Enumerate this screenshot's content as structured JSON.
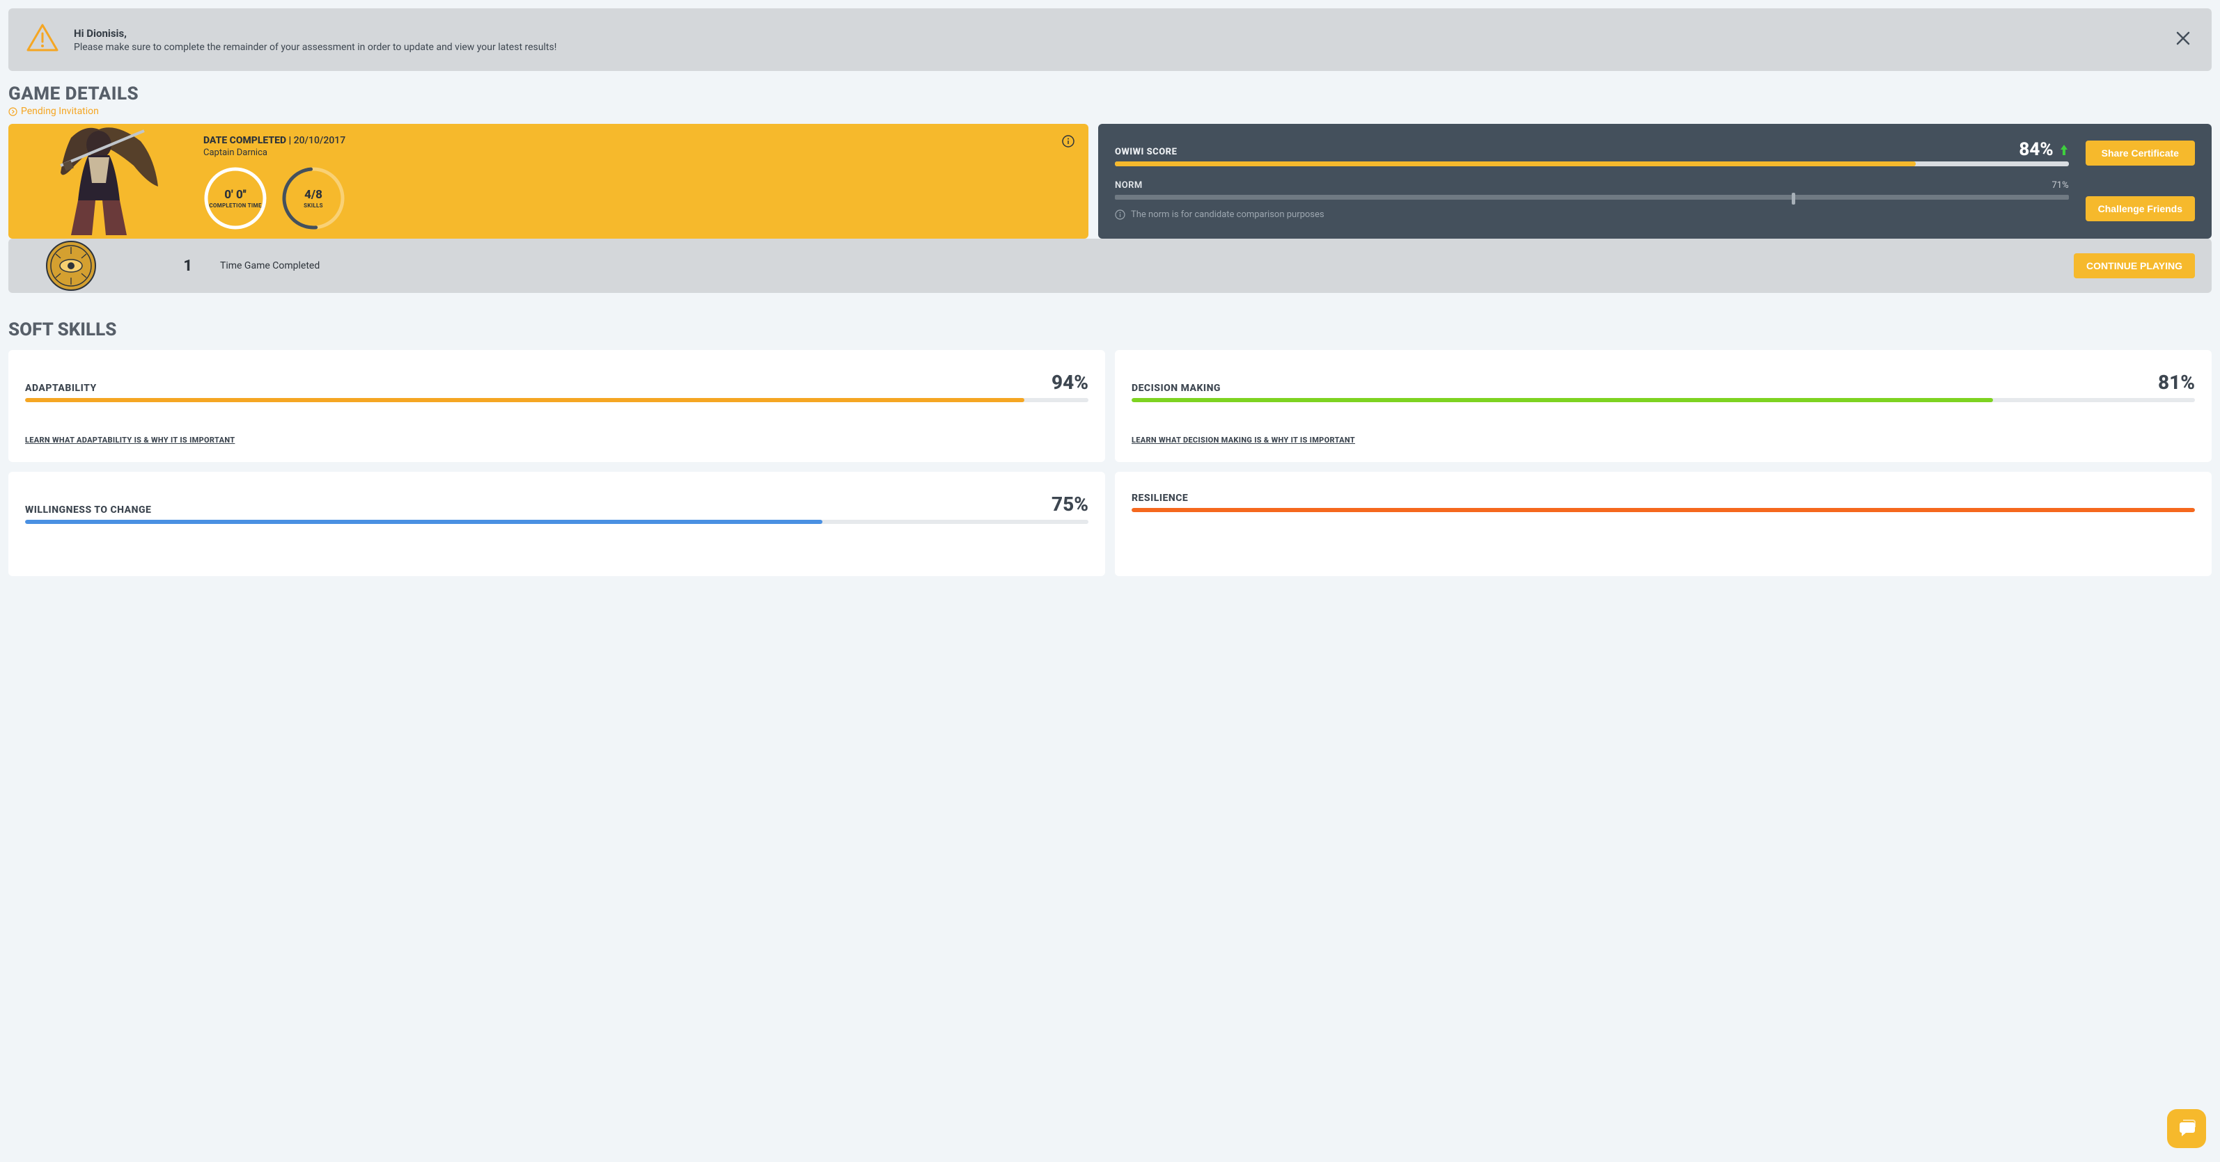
{
  "alert": {
    "greeting": "Hi Dionisis,",
    "message": "Please make sure to complete the remainder of your assessment in order to update and view your latest results!"
  },
  "section_game_details": "GAME DETAILS",
  "pending": "Pending Invitation",
  "game": {
    "date_label": "DATE COMPLETED |",
    "date_value": "20/10/2017",
    "character": "Captain Darnica",
    "completion_time_value": "0' 0''",
    "completion_time_label": "COMPLETION TIME",
    "skills_value": "4/8",
    "skills_label": "SKILLS"
  },
  "score": {
    "label": "OWIWI SCORE",
    "percent": 84,
    "display": "84%",
    "norm_label": "NORM",
    "norm_percent": 71,
    "norm_display": "71%",
    "norm_note": "The norm is for candidate comparison purposes",
    "share_btn": "Share Certificate",
    "challenge_btn": "Challenge Friends"
  },
  "completed": {
    "count": "1",
    "label": "Time Game Completed",
    "continue_btn": "CONTINUE PLAYING"
  },
  "section_soft_skills": "SOFT SKILLS",
  "skills": [
    {
      "name": "ADAPTABILITY",
      "percent": 94,
      "display": "94%",
      "color": "#f5a623",
      "link": "LEARN WHAT ADAPTABILITY IS & WHY IT IS IMPORTANT"
    },
    {
      "name": "DECISION MAKING",
      "percent": 81,
      "display": "81%",
      "color": "#7ed321",
      "link": "LEARN WHAT DECISION MAKING IS & WHY IT IS IMPORTANT"
    },
    {
      "name": "WILLINGNESS TO CHANGE",
      "percent": 75,
      "display": "75%",
      "color": "#4a90e2",
      "link": ""
    },
    {
      "name": "RESILIENCE",
      "percent": 100,
      "display": "",
      "color": "#f5681e",
      "link": ""
    }
  ],
  "colors": {
    "brand_yellow": "#f6b92c",
    "up_green": "#3ecf3e"
  }
}
